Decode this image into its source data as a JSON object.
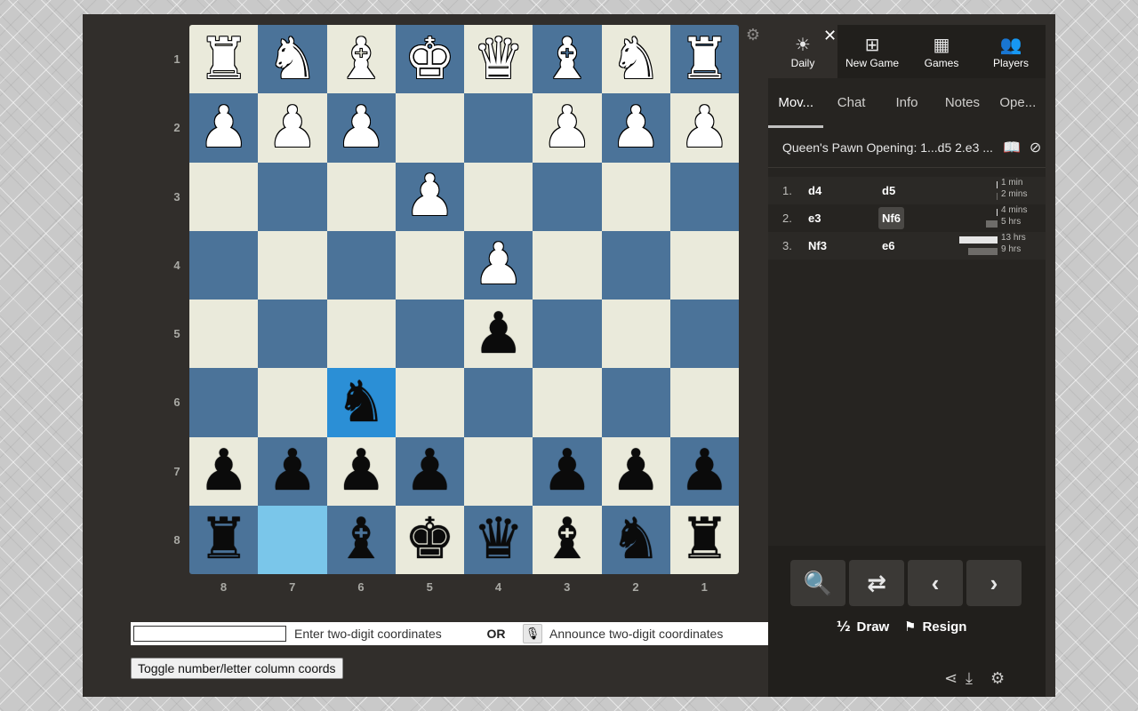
{
  "board": {
    "rank_labels": [
      "1",
      "2",
      "3",
      "4",
      "5",
      "6",
      "7",
      "8"
    ],
    "file_labels": [
      "8",
      "7",
      "6",
      "5",
      "4",
      "3",
      "2",
      "1"
    ],
    "squares": [
      [
        "wR",
        "wN",
        "wB",
        "wK",
        "wQ",
        "wB",
        "wN",
        "wR"
      ],
      [
        "wP",
        "wP",
        "wP",
        "",
        "",
        "wP",
        "wP",
        "wP"
      ],
      [
        "",
        "",
        "",
        "wP",
        "",
        "",
        "",
        ""
      ],
      [
        "",
        "",
        "",
        "",
        "wP",
        "",
        "",
        ""
      ],
      [
        "",
        "",
        "",
        "",
        "bP",
        "",
        "",
        ""
      ],
      [
        "",
        "",
        "bN",
        "",
        "",
        "",
        "",
        ""
      ],
      [
        "bP",
        "bP",
        "bP",
        "bP",
        "",
        "bP",
        "bP",
        "bP"
      ],
      [
        "bR",
        "",
        "bB",
        "bK",
        "bQ",
        "bB",
        "bN",
        "bR"
      ]
    ],
    "highlights": {
      "5-2": "bright",
      "7-1": "light"
    },
    "glyphs": {
      "K": "♚",
      "Q": "♛",
      "R": "♜",
      "B": "♝",
      "N": "♞",
      "P": "♟"
    },
    "settings_icon": "gear-icon"
  },
  "coord_input": {
    "placeholder_text": "Enter two-digit coordinates",
    "or_label": "OR",
    "mic_icon": "microphone-icon",
    "voice_text": "Announce two-digit coordinates",
    "toggle_label": "Toggle number/letter column coords"
  },
  "sidebar": {
    "nav": [
      {
        "label": "Daily",
        "icon": "sun-icon"
      },
      {
        "label": "New Game",
        "icon": "plus-square-icon"
      },
      {
        "label": "Games",
        "icon": "board-icon"
      },
      {
        "label": "Players",
        "icon": "players-icon"
      }
    ],
    "tabs": [
      "Mov...",
      "Chat",
      "Info",
      "Notes",
      "Ope..."
    ],
    "active_tab": 0,
    "opening": "Queen's Pawn Opening: 1...d5 2.e3 ...",
    "moves": [
      {
        "num": "1.",
        "white": "d4",
        "black": "d5",
        "white_time": "1 min",
        "black_time": "2 mins",
        "white_bar": 0.0,
        "black_bar": 0.0
      },
      {
        "num": "2.",
        "white": "e3",
        "black": "Nf6",
        "white_time": "4 mins",
        "black_time": "5 hrs",
        "white_bar": 0.0,
        "black_bar": 0.18,
        "current": true
      },
      {
        "num": "3.",
        "white": "Nf3",
        "black": "e6",
        "white_time": "13 hrs",
        "black_time": "9 hrs",
        "white_bar": 0.62,
        "black_bar": 0.47
      }
    ],
    "controls": {
      "analysis_icon": "magnifier-icon",
      "flip_icon": "shuffle-icon",
      "prev_icon": "chevron-left-icon",
      "next_icon": "chevron-right-icon",
      "draw_symbol": "½",
      "draw_label": "Draw",
      "resign_label": "Resign",
      "footer_icons": [
        "share-icon",
        "download-icon",
        "gear-icon"
      ]
    }
  }
}
